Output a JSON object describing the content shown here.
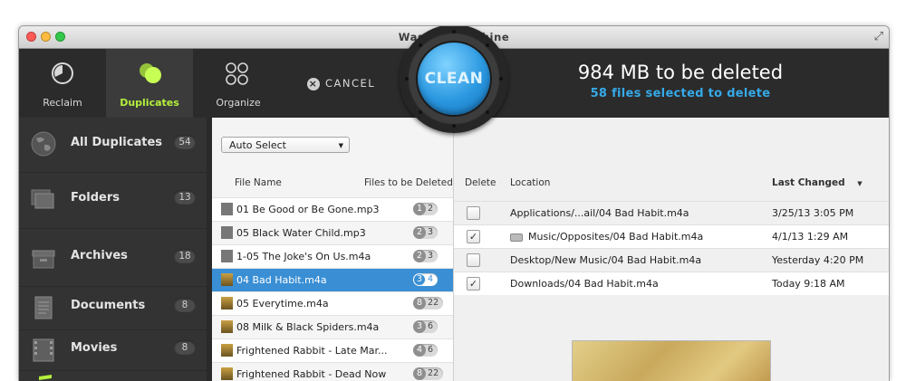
{
  "window": {
    "title": "Washing Machine"
  },
  "toolbar": {
    "tabs": [
      {
        "label": "Reclaim"
      },
      {
        "label": "Duplicates"
      },
      {
        "label": "Organize"
      }
    ],
    "cancel_label": "CANCEL",
    "clean_label": "CLEAN",
    "summary_size": "984 MB to be deleted",
    "summary_files": "58 files selected to delete"
  },
  "sidebar": {
    "items": [
      {
        "label": "All Duplicates",
        "count": "54"
      },
      {
        "label": "Folders",
        "count": "13"
      },
      {
        "label": "Archives",
        "count": "18"
      },
      {
        "label": "Documents",
        "count": "8"
      },
      {
        "label": "Movies",
        "count": "8"
      }
    ]
  },
  "file_panel": {
    "auto_select": "Auto Select",
    "col_file_name": "File Name",
    "col_files_to_delete": "Files to be Deleted",
    "files": [
      {
        "name": "01 Be Good or Be Gone.mp3",
        "del": "1",
        "total": "2"
      },
      {
        "name": "05 Black Water Child.mp3",
        "del": "2",
        "total": "3"
      },
      {
        "name": "1-05 The Joke's On Us.m4a",
        "del": "2",
        "total": "3"
      },
      {
        "name": "04 Bad Habit.m4a",
        "del": "3",
        "total": "4"
      },
      {
        "name": "05 Everytime.m4a",
        "del": "8",
        "total": "22"
      },
      {
        "name": "08 Milk & Black Spiders.m4a",
        "del": "3",
        "total": "6"
      },
      {
        "name": "Frightened Rabbit - Late Mar...",
        "del": "4",
        "total": "6"
      },
      {
        "name": "Frightened Rabbit - Dead Now",
        "del": "8",
        "total": "22"
      }
    ]
  },
  "location_panel": {
    "col_delete": "Delete",
    "col_location": "Location",
    "col_last_changed": "Last Changed",
    "rows": [
      {
        "checked": "",
        "location": "Applications/...ail/04 Bad Habit.m4a",
        "date": "3/25/13 3:05 PM"
      },
      {
        "checked": "✓",
        "location": "Music/Opposites/04 Bad Habit.m4a",
        "date": "4/1/13 1:29 AM"
      },
      {
        "checked": "",
        "location": "Desktop/New Music/04 Bad Habit.m4a",
        "date": "Yesterday 4:20 PM"
      },
      {
        "checked": "✓",
        "location": "Downloads/04 Bad Habit.m4a",
        "date": "Today 9:18 AM"
      }
    ]
  }
}
